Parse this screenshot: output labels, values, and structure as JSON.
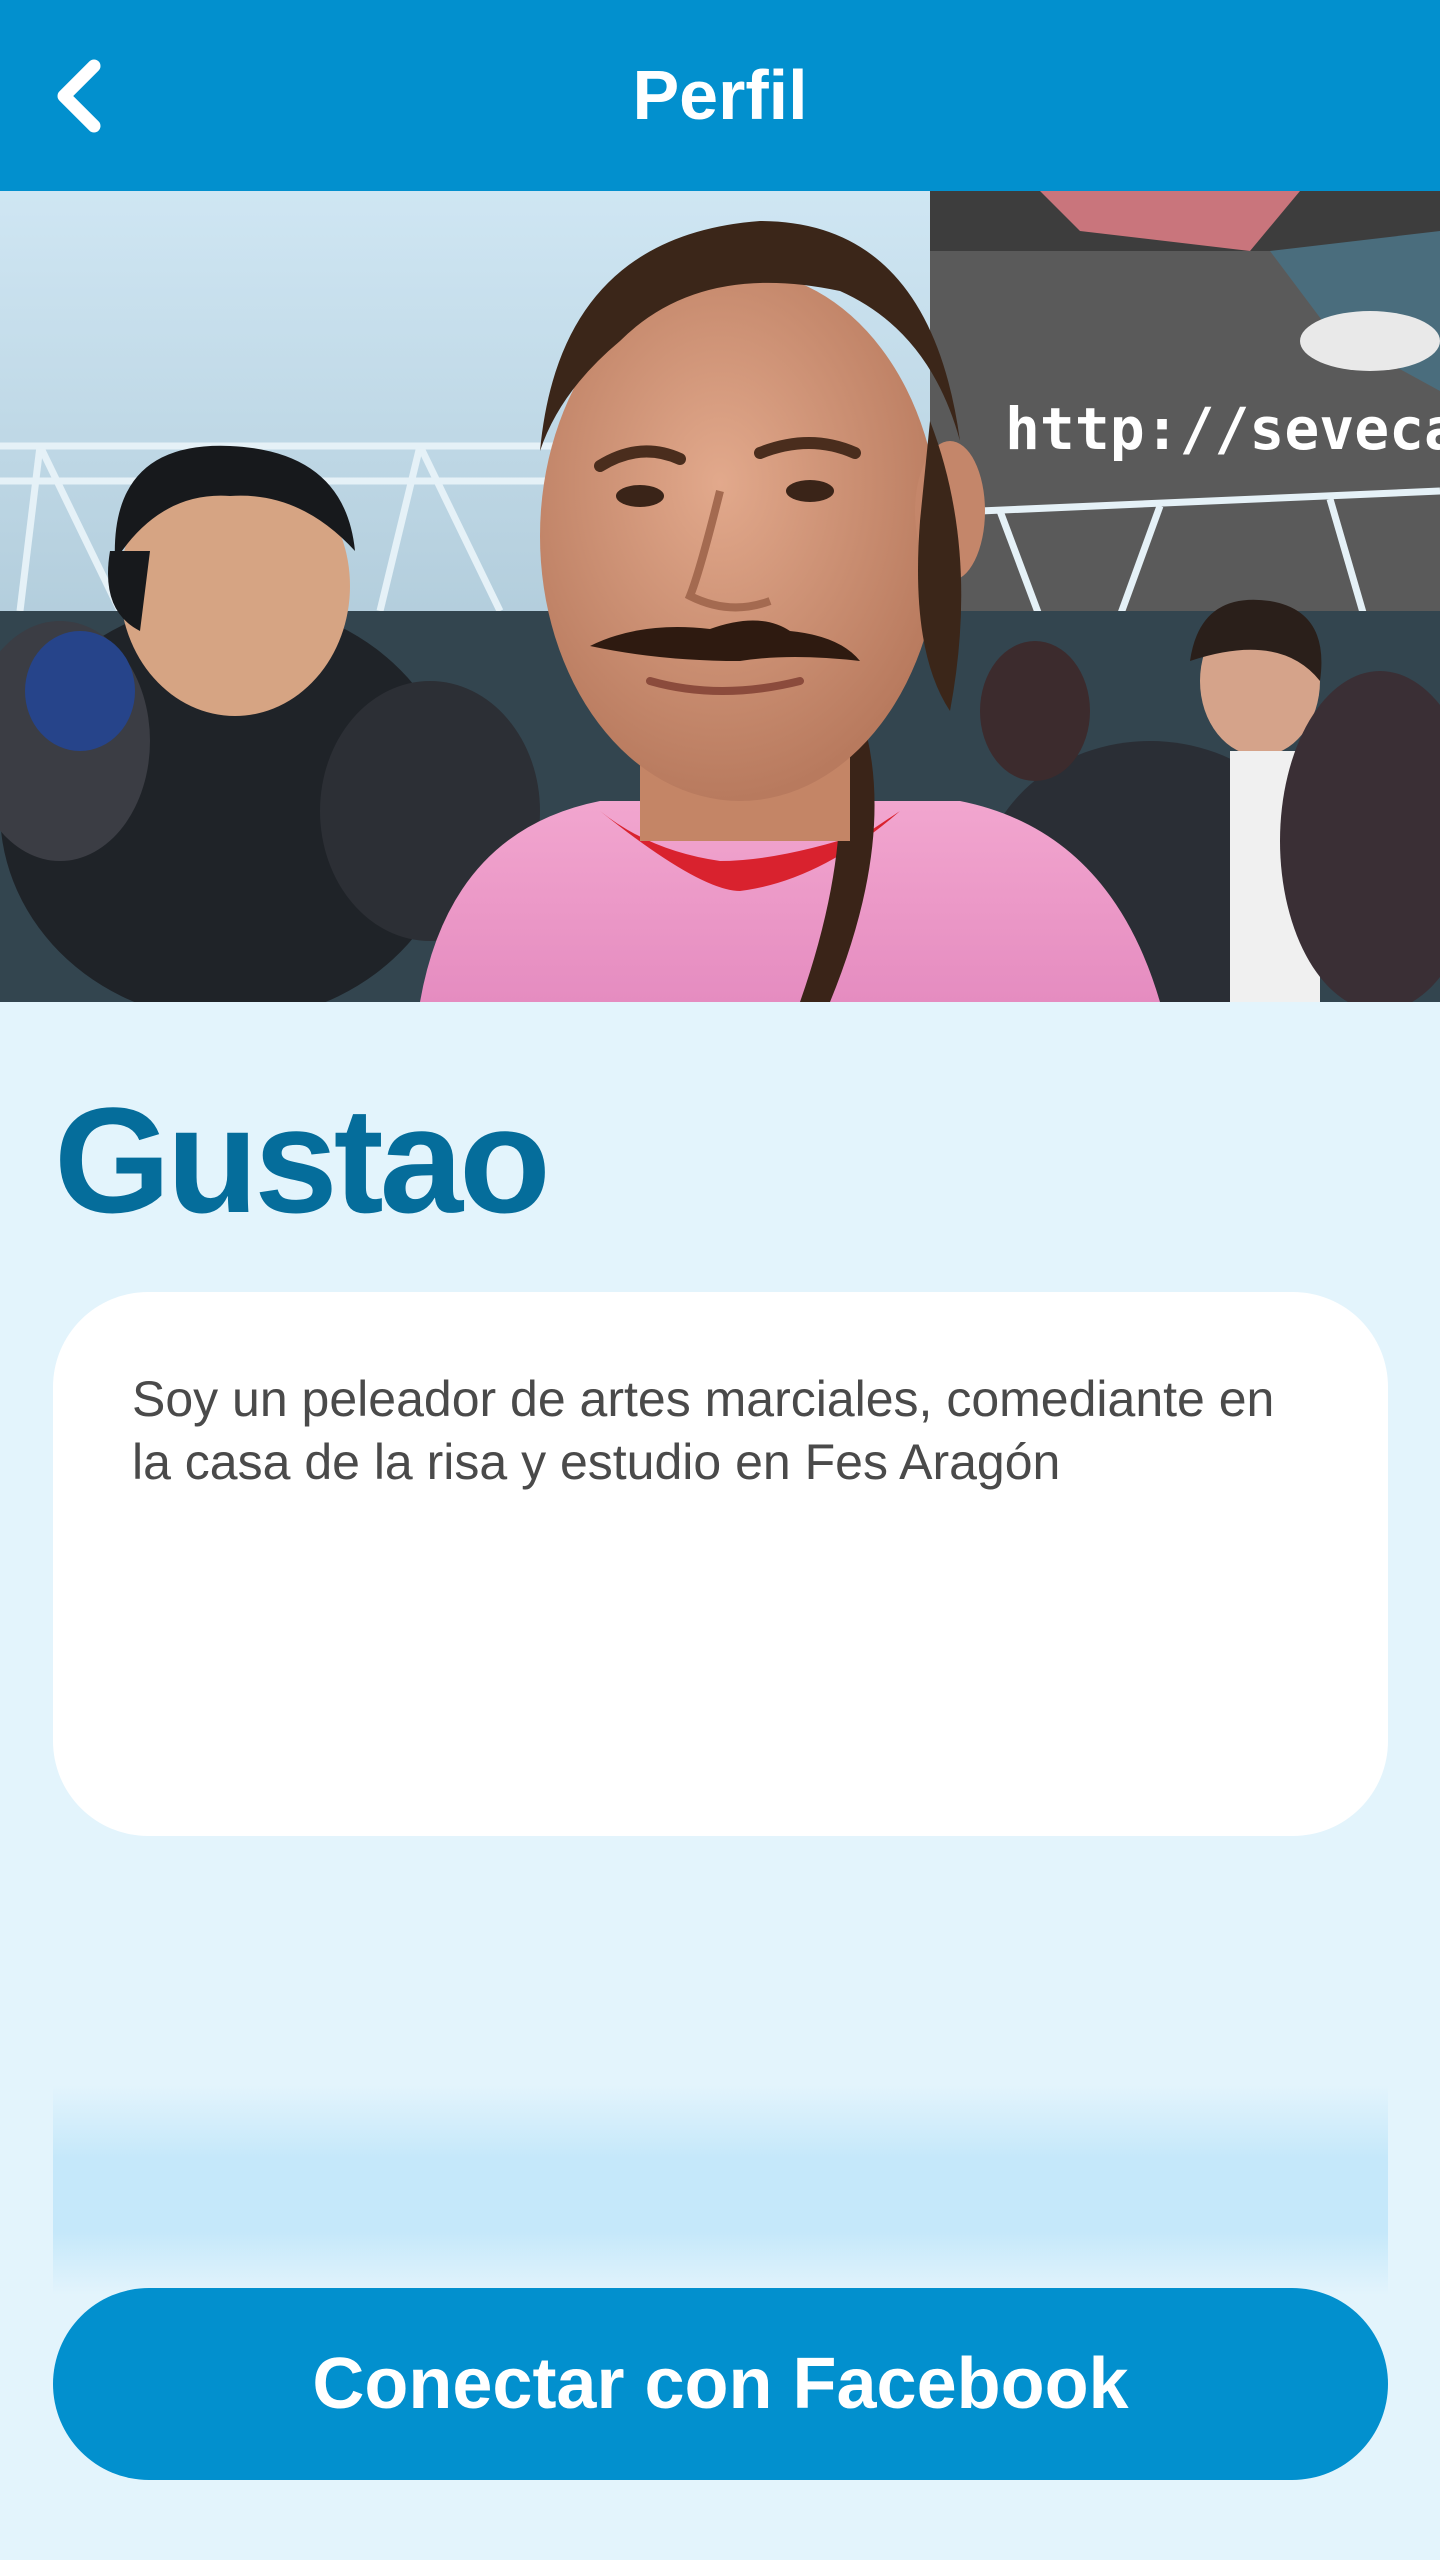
{
  "header": {
    "title": "Perfil",
    "back_icon": "chevron-left-icon"
  },
  "profile": {
    "photo_watermark": "http://seveca",
    "name": "Gustao",
    "bio": "Soy un peleador de artes marciales, comediante en la casa de la risa y estudio en Fes Aragón"
  },
  "actions": {
    "facebook_label": "Conectar con Facebook"
  },
  "colors": {
    "primary": "#0290ce",
    "background": "#e3f4fc",
    "name": "#056d9b",
    "card": "#ffffff",
    "bio_text": "#4a4a4a"
  }
}
